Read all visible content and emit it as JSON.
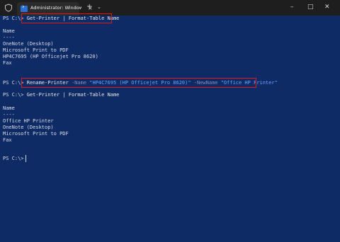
{
  "window": {
    "tab_title": "Administrator: Windows Pow",
    "tab_close": "×",
    "new_tab": "+",
    "dropdown": "⌄",
    "minimize": "–",
    "maximize": "□",
    "close": "✕"
  },
  "terminal": {
    "prompt": "PS C:\\>",
    "cmd1": "Get-Printer | Format-Table Name",
    "out1_header": "Name",
    "out1_sep": "----",
    "out1_rows": [
      "OneNote (Desktop)",
      "Microsoft Print to PDF",
      "HP4C7695 (HP Officejet Pro 8620)",
      "Fax"
    ],
    "cmd2_verb": "Rename-Printer",
    "cmd2_p1": "-Name",
    "cmd2_v1": "\"HP4C7695 (HP Officejet Pro 8620)\"",
    "cmd2_p2": "-NewName",
    "cmd2_v2": "\"Office HP Printer\"",
    "cmd3": "Get-Printer | Format-Table Name",
    "out2_header": "Name",
    "out2_sep": "----",
    "out2_rows": [
      "Office HP Printer",
      "OneNote (Desktop)",
      "Microsoft Print to PDF",
      "Fax"
    ]
  },
  "colors": {
    "background": "#0f2b66",
    "highlight_box": "#e01919",
    "string_color": "#6aa2ff"
  }
}
